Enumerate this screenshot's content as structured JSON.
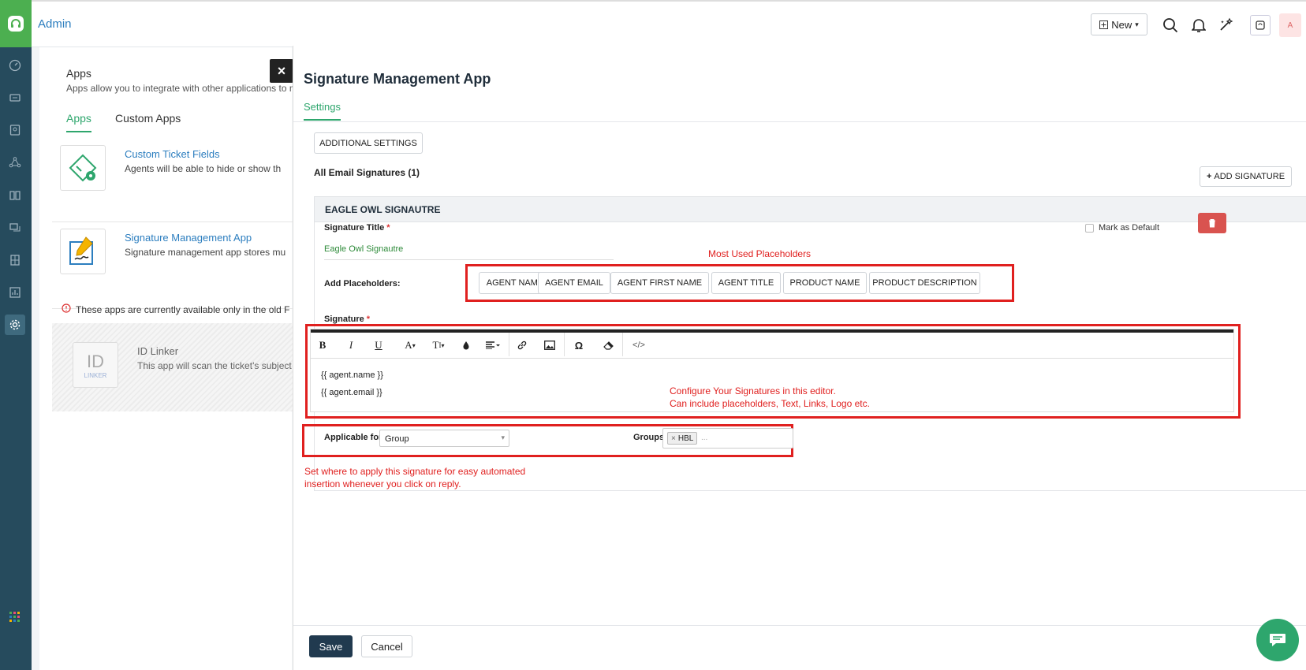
{
  "topbar": {
    "title": "Admin",
    "new_label": "New",
    "avatar_initial": "A"
  },
  "left_panel": {
    "title": "Apps",
    "subtitle": "Apps allow you to integrate with other applications to ma",
    "tabs": [
      {
        "label": "Apps",
        "active": true
      },
      {
        "label": "Custom Apps",
        "active": false
      }
    ],
    "apps": [
      {
        "name": "Custom Ticket Fields",
        "desc": "Agents will be able to hide or show th"
      },
      {
        "name": "Signature Management App",
        "desc": "Signature management app stores mu"
      },
      {
        "name": "ID Linker",
        "desc": "This app will scan the ticket's subject a",
        "icon_text": "ID",
        "icon_sub": "LINKER"
      }
    ],
    "notice": "These apps are currently available only in the old F"
  },
  "modal": {
    "title": "Signature Management App",
    "tab": "Settings",
    "additional_settings": "ADDITIONAL SETTINGS",
    "all_signatures": "All Email Signatures (1)",
    "add_signature": "ADD SIGNATURE",
    "signature_card": {
      "header": "EAGLE OWL SIGNAUTRE",
      "title_label": "Signature Title",
      "title_value": "Eagle Owl Signautre",
      "mark_default": "Mark as Default",
      "add_placeholders_label": "Add Placeholders:",
      "placeholders": [
        "AGENT NAME",
        "AGENT EMAIL",
        "AGENT FIRST NAME",
        "AGENT TITLE",
        "PRODUCT NAME",
        "PRODUCT DESCRIPTION"
      ],
      "signature_label": "Signature",
      "editor_lines": [
        "{{ agent.name }}",
        "{{ agent.email }}"
      ],
      "applicable_label": "Applicable for",
      "applicable_value": "Group",
      "groups_label": "Groups",
      "group_tags": [
        "HBL"
      ]
    },
    "annotations": {
      "placeholders": "Most Used Placeholders",
      "editor_line1": "Configure Your Signatures in this editor.",
      "editor_line2": "Can include placeholders, Text, Links, Logo etc.",
      "apply_line1": "Set where to apply this signature for easy automated",
      "apply_line2": "insertion whenever you click on reply."
    },
    "footer": {
      "save": "Save",
      "cancel": "Cancel"
    }
  },
  "colors": {
    "brand_green": "#2ea66d",
    "rail": "#264b5d",
    "annotation_red": "#e0201f",
    "save_btn": "#213a4f",
    "delete_btn": "#d9534f"
  }
}
